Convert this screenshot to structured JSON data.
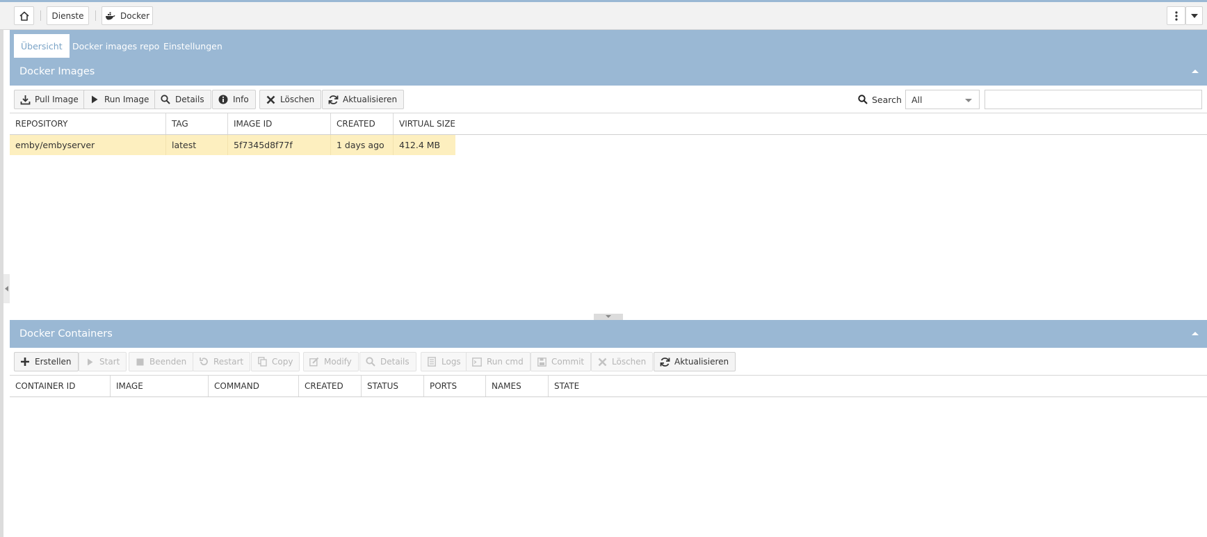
{
  "topbar": {
    "home_icon": "home-icon",
    "breadcrumb": [
      {
        "label": "Dienste"
      },
      {
        "label": "Docker",
        "icon": "docker-icon"
      }
    ],
    "menu_icon": "vertical-dots-icon",
    "dropdown_icon": "caret-down-icon"
  },
  "tabs": [
    {
      "label": "Übersicht",
      "active": true
    },
    {
      "label": "Docker images repo",
      "active": false
    },
    {
      "label": "Einstellungen",
      "active": false
    }
  ],
  "images_panel": {
    "title": "Docker Images",
    "toolbar": [
      {
        "label": "Pull Image",
        "icon": "download-icon"
      },
      {
        "label": "Run Image",
        "icon": "play-icon"
      },
      {
        "label": "Details",
        "icon": "search-icon"
      },
      {
        "label": "Info",
        "icon": "info-icon"
      },
      {
        "label": "Löschen",
        "icon": "close-icon"
      },
      {
        "label": "Aktualisieren",
        "icon": "refresh-icon"
      }
    ],
    "search": {
      "label": "Search",
      "select_value": "All",
      "input_value": ""
    },
    "columns": [
      "REPOSITORY",
      "TAG",
      "IMAGE ID",
      "CREATED",
      "VIRTUAL SIZE"
    ],
    "rows": [
      [
        "emby/embyserver",
        "latest",
        "5f7345d8f77f",
        "1 days ago",
        "412.4 MB"
      ]
    ]
  },
  "containers_panel": {
    "title": "Docker Containers",
    "toolbar": [
      {
        "label": "Erstellen",
        "icon": "plus-icon",
        "enabled": true
      },
      {
        "label": "Start",
        "icon": "play-icon",
        "enabled": false
      },
      {
        "label": "Beenden",
        "icon": "stop-icon",
        "enabled": false
      },
      {
        "label": "Restart",
        "icon": "undo-icon",
        "enabled": false
      },
      {
        "label": "Copy",
        "icon": "copy-icon",
        "enabled": false
      },
      {
        "label": "Modify",
        "icon": "edit-icon",
        "enabled": false
      },
      {
        "label": "Details",
        "icon": "search-icon",
        "enabled": false
      },
      {
        "label": "Logs",
        "icon": "logs-icon",
        "enabled": false
      },
      {
        "label": "Run cmd",
        "icon": "terminal-icon",
        "enabled": false
      },
      {
        "label": "Commit",
        "icon": "save-icon",
        "enabled": false
      },
      {
        "label": "Löschen",
        "icon": "close-icon",
        "enabled": false
      },
      {
        "label": "Aktualisieren",
        "icon": "refresh-icon",
        "enabled": true
      }
    ],
    "columns": [
      "CONTAINER ID",
      "IMAGE",
      "COMMAND",
      "CREATED",
      "STATUS",
      "PORTS",
      "NAMES",
      "STATE"
    ],
    "rows": []
  },
  "colors": {
    "header_blue": "#9ab8d4",
    "selected_row": "#fdefbf",
    "active_tab_text": "#7aa3c6"
  }
}
